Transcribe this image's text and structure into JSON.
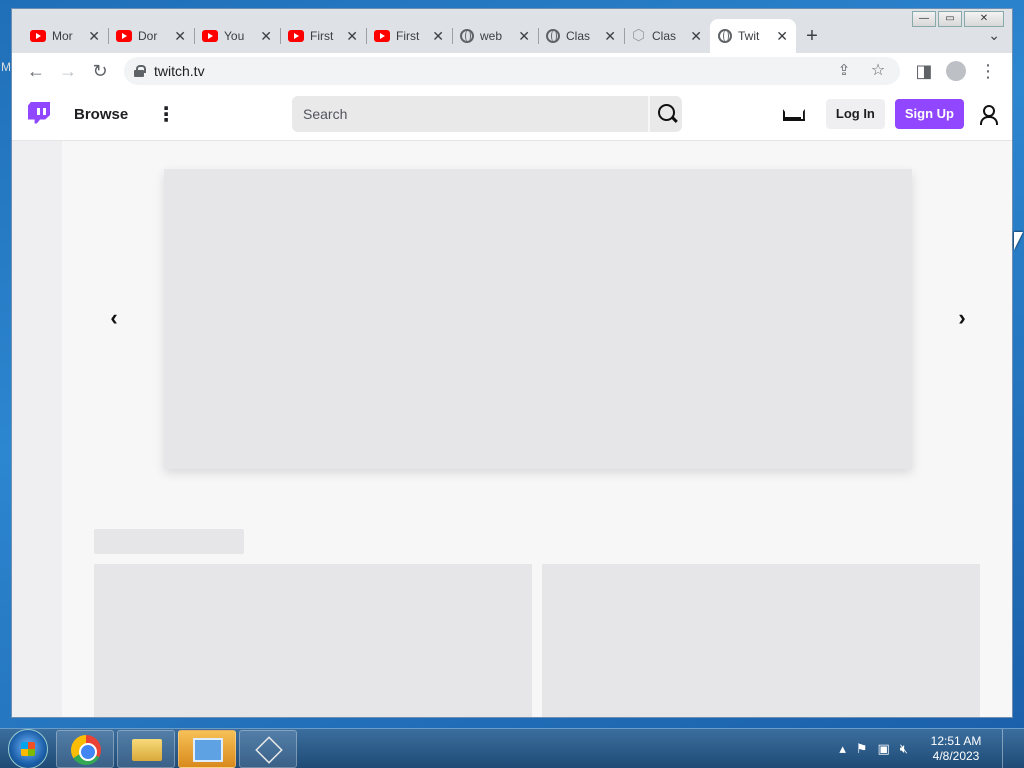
{
  "browser": {
    "tabs": [
      {
        "title": "Mor",
        "favicon": "youtube-icon"
      },
      {
        "title": "Dor",
        "favicon": "youtube-icon"
      },
      {
        "title": "You",
        "favicon": "youtube-icon"
      },
      {
        "title": "First",
        "favicon": "youtube-icon"
      },
      {
        "title": "First",
        "favicon": "youtube-icon"
      },
      {
        "title": "web",
        "favicon": "globe-icon"
      },
      {
        "title": "Clas",
        "favicon": "globe-icon"
      },
      {
        "title": "Clas",
        "favicon": "hexagon-icon"
      },
      {
        "title": "Twit",
        "favicon": "globe-icon",
        "active": true
      }
    ],
    "new_tab": "+",
    "url": "twitch.tv"
  },
  "twitch": {
    "browse_label": "Browse",
    "search_placeholder": "Search",
    "login_label": "Log In",
    "signup_label": "Sign Up",
    "brand_color": "#9146ff"
  },
  "taskbar": {
    "apps": [
      "chrome-icon",
      "folder-icon",
      "control-panel-icon",
      "cube-icon"
    ],
    "time": "12:51 AM",
    "date": "4/8/2023"
  }
}
